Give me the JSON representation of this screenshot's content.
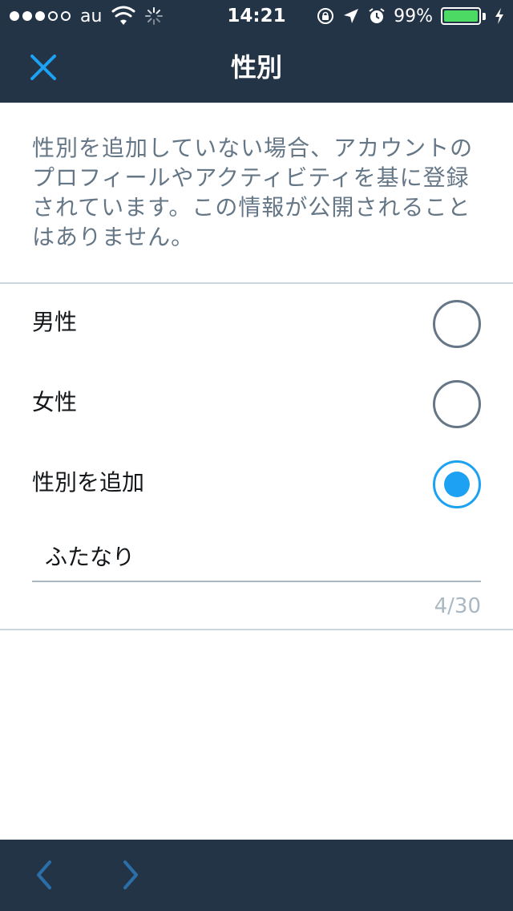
{
  "status_bar": {
    "carrier": "au",
    "time": "14:21",
    "battery_percent_label": "99%",
    "battery_level": 0.99,
    "signal_strength": 3,
    "signal_max": 5,
    "icons": [
      "signal-dots-icon",
      "wifi-icon",
      "activity-spinner-icon",
      "rotation-lock-icon",
      "location-arrow-icon",
      "alarm-icon",
      "battery-icon",
      "charging-bolt-icon"
    ]
  },
  "header": {
    "title": "性別",
    "close_icon": "close-icon"
  },
  "description": "性別を追加していない場合、アカウントのプロフィールやアクティビティを基に登録されています。この情報が公開されることはありません。",
  "options": [
    {
      "label": "男性",
      "selected": false
    },
    {
      "label": "女性",
      "selected": false
    },
    {
      "label": "性別を追加",
      "selected": true
    }
  ],
  "custom_gender": {
    "value": "ふたなり",
    "counter": "4/30"
  },
  "toolbar": {
    "back_icon": "chevron-left-icon",
    "forward_icon": "chevron-right-icon"
  },
  "colors": {
    "nav_background": "#243447",
    "accent": "#1da1f2",
    "secondary_text": "#657786",
    "divider": "#ccd6dd",
    "battery_fill": "#4cd964"
  }
}
